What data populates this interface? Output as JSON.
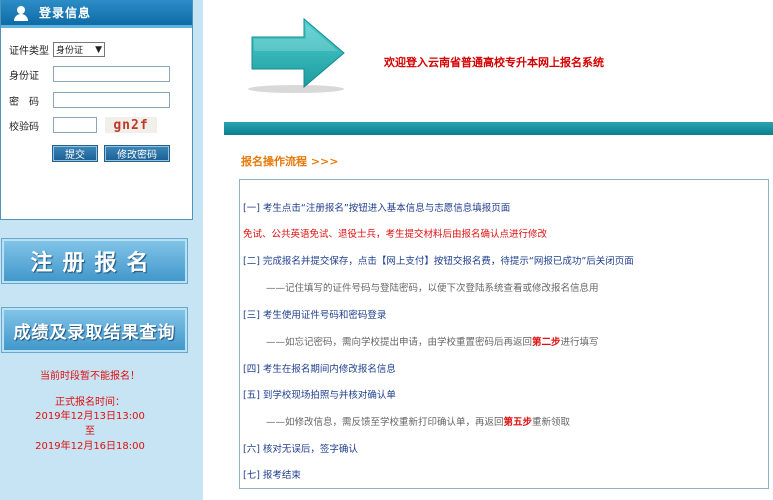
{
  "login": {
    "header": "登录信息",
    "id_type_label": "证件类型",
    "id_type_value": "身份证",
    "id_number_label": "身份证",
    "password_label": "密　码",
    "captcha_label": "校验码",
    "captcha_text": "gn2f",
    "submit_label": "提交",
    "change_password_label": "修改密码"
  },
  "buttons": {
    "register": "注册报名",
    "query": "成绩及录取结果查询"
  },
  "notice": {
    "cannot_register": "当前时段暂不能报名！",
    "period_title": "正式报名时间：",
    "start": "2019年12月13日13:00",
    "to": "至",
    "end": "2019年12月16日18:00"
  },
  "header": {
    "welcome": "欢迎登入云南省普通高校专升本网上报名系统"
  },
  "flow": {
    "title": "报名操作流程 >>>",
    "step1": "[一] 考生点击“注册报名”按钮进入基本信息与志愿信息填报页面",
    "note_exempt": "免试、公共英语免试、退役士兵，考生提交材料后由报名确认点进行修改",
    "step2": "[二] 完成报名并提交保存，点击【网上支付】按钮交报名费，待提示“网报已成功”后关闭页面",
    "step2_note": "——记住填写的证件号码与登陆密码，以便下次登陆系统查看或修改报名信息用",
    "step3": "[三] 考生使用证件号码和密码登录",
    "step3_note_a": "——如忘记密码，需向学校提出申请，由学校重置密码后再返回",
    "step3_note_em": "第二步",
    "step3_note_b": "进行填写",
    "step4": "[四] 考生在报名期间内修改报名信息",
    "step5": "[五] 到学校现场拍照与并核对确认单",
    "step5_note_a": "——如修改信息，需反馈至学校重新打印确认单，再返回",
    "step5_note_em": "第五步",
    "step5_note_b": "重新领取",
    "step6": "[六] 核对无误后，签字确认",
    "step7": "[七] 报考结束"
  },
  "colors": {
    "accent_blue": "#0f6aa6",
    "teal_bar": "#1a93a3",
    "welcome_red": "#d60000",
    "flow_orange": "#e87a0c",
    "step_blue": "#1f3f8c"
  }
}
